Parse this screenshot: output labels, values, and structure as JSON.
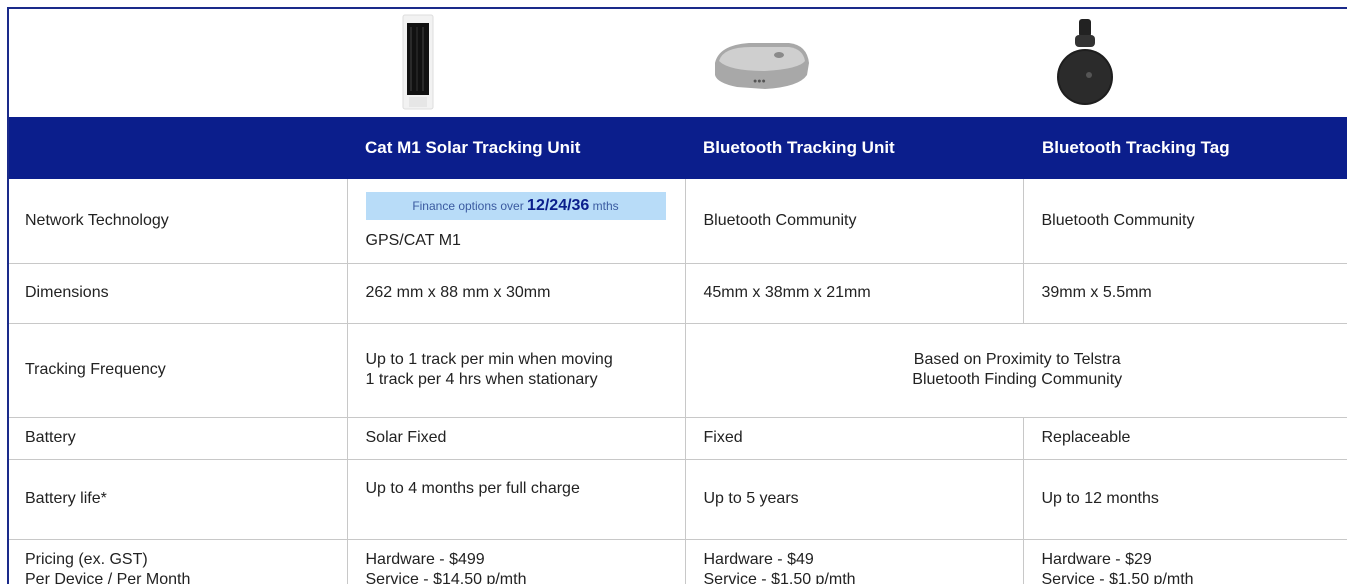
{
  "products": [
    {
      "name": "Cat M1 Solar Tracking Unit",
      "image": "solar-tracker-image"
    },
    {
      "name": "Bluetooth Tracking Unit",
      "image": "bluetooth-unit-image"
    },
    {
      "name": "Bluetooth Tracking Tag",
      "image": "bluetooth-tag-image"
    }
  ],
  "finance": {
    "prefix": "Finance options over ",
    "terms": "12/24/36",
    "suffix": " mths"
  },
  "rows": {
    "network": {
      "label": "Network Technology",
      "solar": "GPS/CAT M1",
      "unit": "Bluetooth Community",
      "tag": "Bluetooth Community"
    },
    "dimensions": {
      "label": "Dimensions",
      "solar": "262 mm x 88 mm x 30mm",
      "unit": "45mm x 38mm x 21mm",
      "tag": "39mm x 5.5mm"
    },
    "frequency": {
      "label": "Tracking Frequency",
      "solar_line1": "Up to 1 track per min when moving",
      "solar_line2": "1 track per 4 hrs when stationary",
      "bt_line1": "Based on Proximity to Telstra",
      "bt_line2": "Bluetooth Finding Community"
    },
    "battery": {
      "label": "Battery",
      "solar": "Solar Fixed",
      "unit": "Fixed",
      "tag": "Replaceable"
    },
    "battery_life": {
      "label": "Battery life*",
      "solar": "Up to 4 months per full charge",
      "unit": "Up to 5 years",
      "tag": "Up to 12 months"
    },
    "pricing": {
      "label_line1": "Pricing (ex. GST)",
      "label_line2": "Per Device / Per Month",
      "solar_hw": "Hardware - $499",
      "solar_svc": "Service - $14.50 p/mth",
      "unit_hw": "Hardware - $49",
      "unit_svc": "Service - $1.50 p/mth",
      "tag_hw": "Hardware - $29",
      "tag_svc": "Service - $1.50 p/mth"
    }
  },
  "colors": {
    "header_bg": "#0b1e8c",
    "finance_bg": "#b8dcf8",
    "border": "#1a2a8a"
  }
}
